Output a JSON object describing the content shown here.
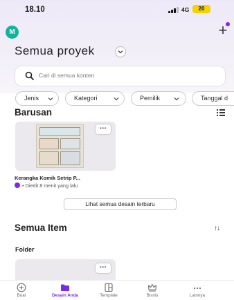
{
  "status_bar": {
    "time": "18.10",
    "network": "4G",
    "battery": "20"
  },
  "header": {
    "avatar_initial": "M",
    "title": "Semua proyek"
  },
  "search": {
    "placeholder": "Cari di semua konten"
  },
  "filters": [
    {
      "label": "Jenis"
    },
    {
      "label": "Kategori"
    },
    {
      "label": "Pemilik"
    },
    {
      "label": "Tanggal d"
    }
  ],
  "recent": {
    "title": "Barusan",
    "design_name": "Kerangka Komik Setrip P...",
    "design_meta": "• Diedit 8 menit yang lalu",
    "see_all_label": "Lihat semua desain terbaru"
  },
  "all_items": {
    "title": "Semua Item",
    "folder_label": "Folder"
  },
  "bottom_nav": [
    {
      "label": "Buat",
      "icon": "plus-circle-icon"
    },
    {
      "label": "Desain Anda",
      "icon": "folder-icon"
    },
    {
      "label": "Template",
      "icon": "template-icon"
    },
    {
      "label": "Bisnis",
      "icon": "crown-icon"
    },
    {
      "label": "Lainnya",
      "icon": "more-icon"
    }
  ],
  "colors": {
    "accent": "#7d2ae8",
    "avatar": "#12b39c",
    "battery": "#f5d200"
  }
}
